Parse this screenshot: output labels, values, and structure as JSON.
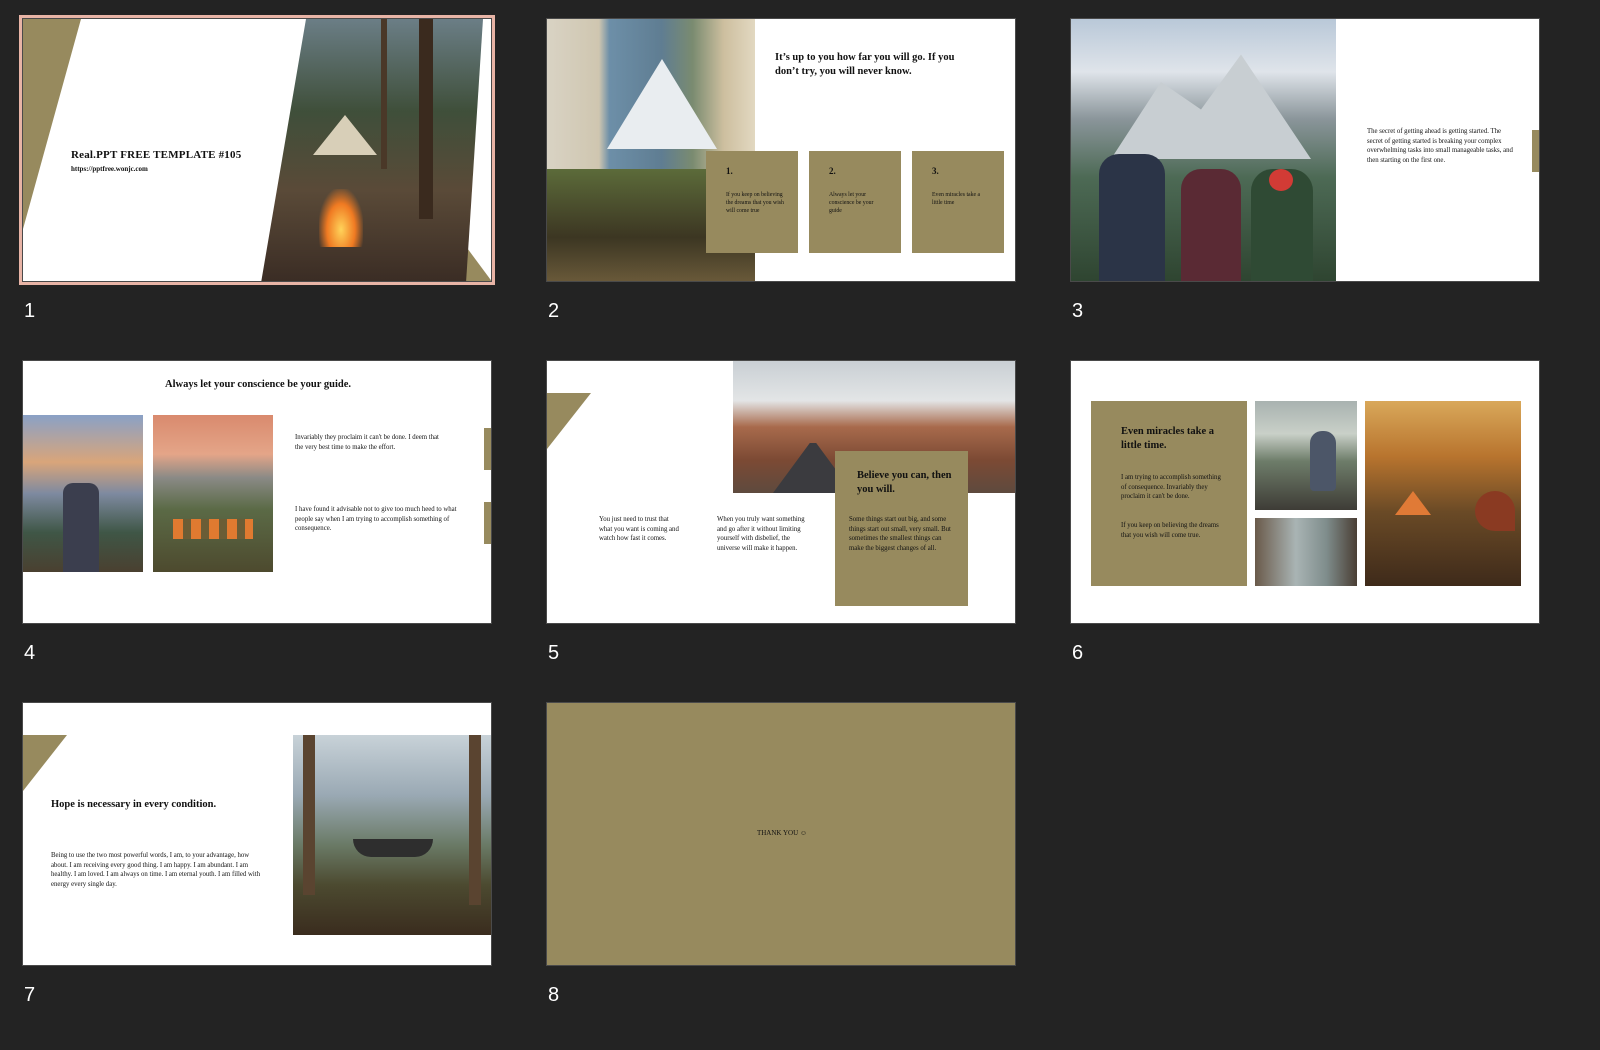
{
  "colors": {
    "background": "#232323",
    "accent": "#978a5e",
    "selected_border": "#e8b4a6"
  },
  "slides": [
    {
      "number": "1",
      "selected": true,
      "title": "Real.PPT FREE TEMPLATE #105",
      "url": "https://pptfree.wonjc.com",
      "image": "campfire-forest-tent-photo"
    },
    {
      "number": "2",
      "heading": "It’s up to you how far you will go. If you don’t try, you will never know.",
      "boxes": [
        {
          "num": "1.",
          "text": "If you keep on believing the dreams that you wish will come true"
        },
        {
          "num": "2.",
          "text": "Always let your conscience be your guide"
        },
        {
          "num": "3.",
          "text": "Even miracles take a little time"
        }
      ],
      "image": "tent-view-mountain-photo"
    },
    {
      "number": "3",
      "text": "The secret of getting ahead is getting started. The secret of getting started is breaking your complex overwhelming tasks into small manageable tasks, and then starting on the first one.",
      "image": "hikers-mountain-photo"
    },
    {
      "number": "4",
      "title": "Always let your conscience be your guide.",
      "para1": "Invariably they proclaim it can't be done. I deem that the very best time to make the effort.",
      "para2": "I have found it advisable not to give too much heed to what people say when I am trying to accomplish something of consequence.",
      "images": [
        "sunset-hiker-photo",
        "camp-mountain-photo"
      ]
    },
    {
      "number": "5",
      "col1": "You just need to trust that what you want is coming and watch how fast it comes.",
      "col2": "When you truly want something and go after it without limiting yourself with disbelief, the universe will make it happen.",
      "box_title": "Believe you can, then you will.",
      "box_text": "Some things start out big, and some things start out small, very small. But sometimes the smallest things can make the biggest changes of all.",
      "image": "desert-road-photo"
    },
    {
      "number": "6",
      "box_title": "Even miracles take a little time.",
      "box_text1": "I am trying to accomplish something of consequence. Invariably they proclaim it can't be done.",
      "box_text2": "If you keep on believing the dreams that you wish will come true.",
      "images": [
        "tent-lake-photo",
        "window-reading-photo",
        "autumn-camp-photo"
      ]
    },
    {
      "number": "7",
      "title": "Hope is necessary in every condition.",
      "text": "Being to use the two most powerful words, I am, to your advantage, how about. I am receiving every good thing. I am happy. I am abundant. I am healthy. I am loved. I am always on time. I am eternal youth. I am filled with energy every single day.",
      "image": "hammock-valley-photo"
    },
    {
      "number": "8",
      "text": "THANK YOU ☺"
    }
  ]
}
